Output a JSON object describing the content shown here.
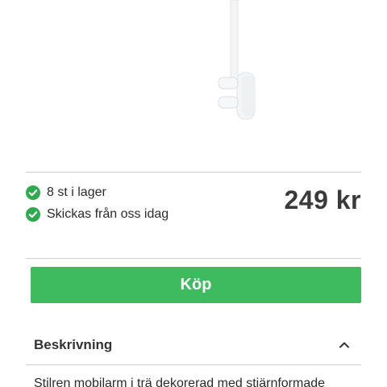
{
  "product": {
    "image_alt": "mobile product image"
  },
  "availability": {
    "in_stock": "8 st i lager",
    "shipping": "Skickas från oss idag"
  },
  "price": "249 kr",
  "buy_button_label": "Köp",
  "accordion": {
    "title": "Beskrivning",
    "expanded": true,
    "body": "Stilren mobilarm i trä dekorerad med stjärnformade"
  },
  "colors": {
    "accent_green": "#3dbb5e",
    "text": "#2b2b2b",
    "divider": "#cfcfcf"
  }
}
